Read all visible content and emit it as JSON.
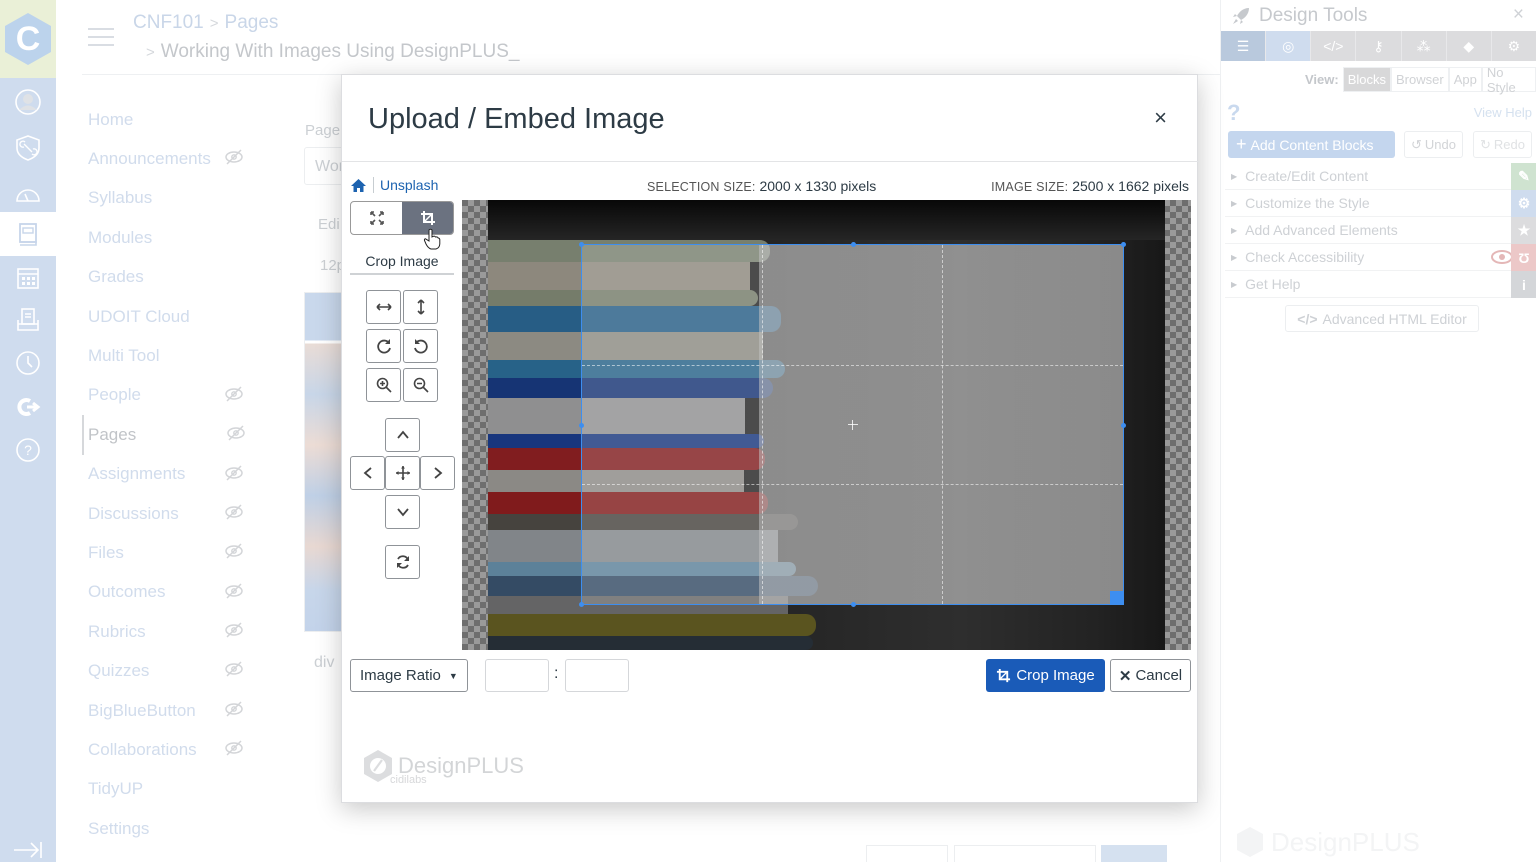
{
  "global_nav": {
    "logo_letter": "C",
    "items": [
      {
        "icon": "account-icon"
      },
      {
        "icon": "admin-icon"
      },
      {
        "icon": "dashboard-icon"
      },
      {
        "icon": "courses-icon",
        "active": true
      },
      {
        "icon": "calendar-icon"
      },
      {
        "icon": "inbox-icon"
      },
      {
        "icon": "history-icon"
      },
      {
        "icon": "commons-icon"
      },
      {
        "icon": "help-icon"
      }
    ],
    "collapse_icon": "collapse-nav-icon"
  },
  "breadcrumb": {
    "course": "CNF101",
    "section": "Pages",
    "page": "Working With Images Using DesignPLUS_"
  },
  "course_nav": {
    "items": [
      {
        "label": "Home",
        "hidden": false
      },
      {
        "label": "Announcements",
        "hidden": true
      },
      {
        "label": "Syllabus",
        "hidden": false
      },
      {
        "label": "Modules",
        "hidden": false
      },
      {
        "label": "Grades",
        "hidden": false
      },
      {
        "label": "UDOIT Cloud",
        "hidden": false
      },
      {
        "label": "Multi Tool",
        "hidden": false
      },
      {
        "label": "People",
        "hidden": true
      },
      {
        "label": "Pages",
        "hidden": true,
        "active": true
      },
      {
        "label": "Assignments",
        "hidden": true
      },
      {
        "label": "Discussions",
        "hidden": true
      },
      {
        "label": "Files",
        "hidden": true
      },
      {
        "label": "Outcomes",
        "hidden": true
      },
      {
        "label": "Rubrics",
        "hidden": true
      },
      {
        "label": "Quizzes",
        "hidden": true
      },
      {
        "label": "BigBlueButton",
        "hidden": true
      },
      {
        "label": "Collaborations",
        "hidden": true
      },
      {
        "label": "TidyUP",
        "hidden": false
      },
      {
        "label": "Settings",
        "hidden": false
      }
    ]
  },
  "editor_background": {
    "page_label": "Page",
    "title_value": "Wor",
    "edit_label": "Edi",
    "font_size": "12p",
    "path_label": "div"
  },
  "design_tools": {
    "title": "Design Tools",
    "close": "×",
    "tabs": [
      "blocks-icon",
      "target-icon",
      "code-icon",
      "key-icon",
      "cubes-icon",
      "tags-icon",
      "gears-icon"
    ],
    "view_label": "View:",
    "view_options": [
      "Blocks",
      "Browser",
      "App",
      "No Style"
    ],
    "view_selected": "Blocks",
    "help_mark": "?",
    "view_help": "View Help",
    "add_blocks": "Add Content Blocks",
    "undo": "Undo",
    "redo": "Redo",
    "sections": [
      {
        "label": "Create/Edit Content",
        "strip_color": "#cfe3d0",
        "strip_icon": "wand-icon"
      },
      {
        "label": "Customize the Style",
        "strip_color": "#cfdcee",
        "strip_icon": "gear-icon"
      },
      {
        "label": "Add Advanced Elements",
        "strip_color": "#dcdcde",
        "strip_icon": "star-icon"
      },
      {
        "label": "Check Accessibility",
        "strip_color": "#ecc8c8",
        "strip_icon": "stethoscope-icon"
      },
      {
        "label": "Get Help",
        "strip_color": "#d4d6d9",
        "strip_icon": "info-icon"
      }
    ],
    "html_editor": "Advanced HTML Editor",
    "watermark": "DesignPLUS"
  },
  "modal": {
    "title": "Upload / Embed Image",
    "close": "×",
    "source_link": "Unsplash",
    "selection_size_label": "SELECTION SIZE:",
    "selection_size_value": "2000 x 1330 pixels",
    "image_size_label": "IMAGE SIZE:",
    "image_size_value": "2500 x 1662 pixels",
    "mode_caption": "Crop Image",
    "mode_selected": "crop",
    "tools": {
      "flip_horizontal": "Flip horizontal",
      "flip_vertical": "Flip vertical",
      "rotate_right": "Rotate right",
      "rotate_left": "Rotate left",
      "zoom_in": "Zoom in",
      "zoom_out": "Zoom out",
      "move_up": "Move up",
      "move_left": "Move left",
      "move": "Move",
      "move_right": "Move right",
      "move_down": "Move down",
      "reset": "Reset"
    },
    "ratio_label": "Image Ratio",
    "ratio_width": "",
    "ratio_height": "",
    "ratio_separator": ":",
    "crop_button": "Crop Image",
    "cancel_button": "Cancel",
    "watermark": "DesignPLUS",
    "watermark_sub": "cidilabs",
    "colors": {
      "primary": "#1a5bb8",
      "crop_box": "#3d8ef0",
      "link": "#1d63b0"
    }
  }
}
